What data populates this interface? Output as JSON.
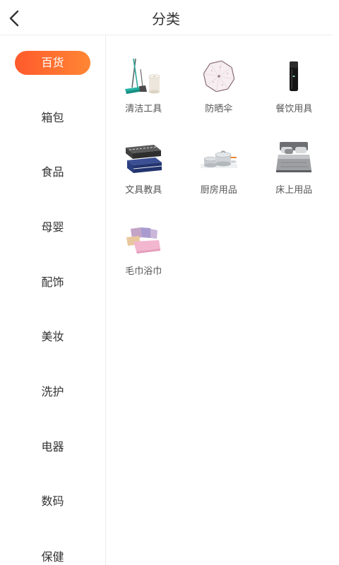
{
  "header": {
    "title": "分类",
    "back_icon": "chevron-left-icon"
  },
  "sidebar": {
    "active_index": 0,
    "items": [
      {
        "label": "百货"
      },
      {
        "label": "箱包"
      },
      {
        "label": "食品"
      },
      {
        "label": "母婴"
      },
      {
        "label": "配饰"
      },
      {
        "label": "美妆"
      },
      {
        "label": "洗护"
      },
      {
        "label": "电器"
      },
      {
        "label": "数码"
      },
      {
        "label": "保健"
      }
    ]
  },
  "main": {
    "categories": [
      {
        "label": "清洁工具",
        "icon": "mop-and-paper-roll-image"
      },
      {
        "label": "防晒伞",
        "icon": "umbrella-top-view-image"
      },
      {
        "label": "餐饮用具",
        "icon": "black-thermos-image"
      },
      {
        "label": "文具教具",
        "icon": "pencil-cases-image"
      },
      {
        "label": "厨房用品",
        "icon": "cookware-set-image"
      },
      {
        "label": "床上用品",
        "icon": "bedding-set-image"
      },
      {
        "label": "毛巾浴巾",
        "icon": "towel-stack-image"
      }
    ]
  },
  "colors": {
    "accent_start": "#ff5a2c",
    "accent_end": "#ff8634",
    "text": "#333333",
    "label": "#555555",
    "divider": "#ececec"
  }
}
